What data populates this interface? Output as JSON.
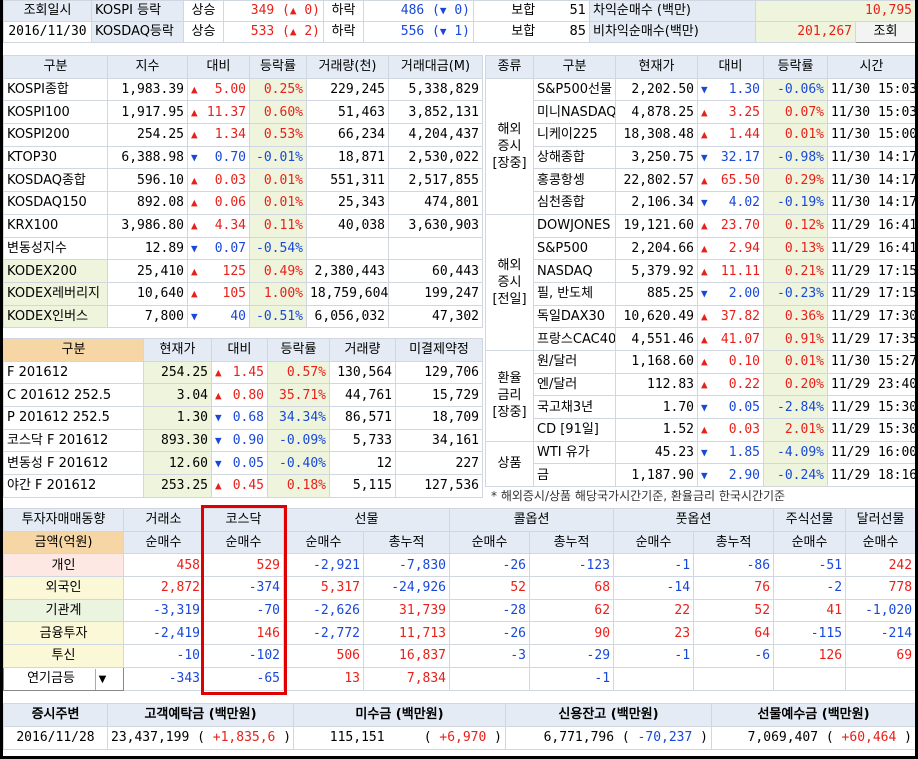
{
  "top": {
    "r1": {
      "c1": "조회일시",
      "c2": "KOSPI 등락",
      "c3": "상승",
      "c4": "349",
      "c5": "0",
      "c6": "하락",
      "c7": "486",
      "c8": "0",
      "c9": "보합",
      "c10": "51",
      "c11": "차익순매수 (백만)",
      "c12": "10,795"
    },
    "r2": {
      "c1": "2016/11/30",
      "c2": "KOSDAQ등락",
      "c3": "상승",
      "c4": "533",
      "c5": "2",
      "c6": "하락",
      "c7": "556",
      "c8": "1",
      "c9": "보합",
      "c10": "85",
      "c11": "비차익순매수(백만)",
      "c12": "201,267"
    },
    "btn": "조회"
  },
  "idx": {
    "headers": [
      "구분",
      "지수",
      "대비",
      "등락률",
      "거래량(천)",
      "거래대금(M)"
    ],
    "rows": [
      [
        "KOSPI종합",
        "1,983.39",
        "up",
        "5.00",
        "0.25%",
        "229,245",
        "5,338,829"
      ],
      [
        "KOSPI100",
        "1,917.95",
        "up",
        "11.37",
        "0.60%",
        "51,463",
        "3,852,131"
      ],
      [
        "KOSPI200",
        "254.25",
        "up",
        "1.34",
        "0.53%",
        "66,234",
        "4,204,437"
      ],
      [
        "KTOP30",
        "6,388.98",
        "dn",
        "0.70",
        "-0.01%",
        "18,871",
        "2,530,022"
      ],
      [
        "KOSDAQ종합",
        "596.10",
        "up",
        "0.03",
        "0.01%",
        "551,311",
        "2,517,855"
      ],
      [
        "KOSDAQ150",
        "892.08",
        "up",
        "0.06",
        "0.01%",
        "25,343",
        "474,801"
      ],
      [
        "KRX100",
        "3,986.80",
        "up",
        "4.34",
        "0.11%",
        "40,038",
        "3,630,903"
      ],
      [
        "변동성지수",
        "12.89",
        "dn",
        "0.07",
        "-0.54%",
        "",
        ""
      ],
      [
        "KODEX200",
        "25,410",
        "up",
        "125",
        "0.49%",
        "2,380,443",
        "60,443"
      ],
      [
        "KODEX레버리지",
        "10,640",
        "up",
        "105",
        "1.00%",
        "18,759,604",
        "199,247"
      ],
      [
        "KODEX인버스",
        "7,800",
        "dn",
        "40",
        "-0.51%",
        "6,056,032",
        "47,302"
      ]
    ]
  },
  "fut": {
    "headers": [
      "구분",
      "현재가",
      "대비",
      "등락률",
      "거래량",
      "미결제약정"
    ],
    "rows": [
      [
        "F 201612",
        "254.25",
        "up",
        "1.45",
        "0.57%",
        "130,564",
        "129,706"
      ],
      [
        "C 201612 252.5",
        "3.04",
        "up",
        "0.80",
        "35.71%",
        "44,761",
        "15,729"
      ],
      [
        "P 201612 252.5",
        "1.30",
        "dn",
        "0.68",
        "34.34%",
        "86,571",
        "18,709"
      ],
      [
        "코스닥 F 201612",
        "893.30",
        "dn",
        "0.90",
        "-0.09%",
        "5,733",
        "34,161"
      ],
      [
        "변동성 F 201612",
        "12.60",
        "dn",
        "0.05",
        "-0.40%",
        "12",
        "227"
      ],
      [
        "야간 F 201612",
        "253.25",
        "up",
        "0.45",
        "0.18%",
        "5,115",
        "127,536"
      ]
    ]
  },
  "ovs": {
    "headers": [
      "종류",
      "구분",
      "현재가",
      "대비",
      "등락률",
      "시간"
    ],
    "groups": [
      "해외\n증시\n[장중]",
      "해외\n증시\n[전일]",
      "환율\n금리\n[장중]",
      "상품"
    ],
    "rows": [
      [
        "S&P500선물",
        "2,202.50",
        "dn",
        "1.30",
        "-0.06%",
        "11/30 15:03"
      ],
      [
        "미니NASDAQ",
        "4,878.25",
        "up",
        "3.25",
        "0.07%",
        "11/30 15:03"
      ],
      [
        "니케이225",
        "18,308.48",
        "up",
        "1.44",
        "0.01%",
        "11/30 15:00"
      ],
      [
        "상해종합",
        "3,250.75",
        "dn",
        "32.17",
        "-0.98%",
        "11/30 14:17"
      ],
      [
        "홍콩항셍",
        "22,802.57",
        "up",
        "65.50",
        "0.29%",
        "11/30 14:17"
      ],
      [
        "심천종합",
        "2,106.34",
        "dn",
        "4.02",
        "-0.19%",
        "11/30 14:17"
      ],
      [
        "DOWJONES",
        "19,121.60",
        "up",
        "23.70",
        "0.12%",
        "11/29 16:41"
      ],
      [
        "S&P500",
        "2,204.66",
        "up",
        "2.94",
        "0.13%",
        "11/29 16:41"
      ],
      [
        "NASDAQ",
        "5,379.92",
        "up",
        "11.11",
        "0.21%",
        "11/29 17:15"
      ],
      [
        "필, 반도체",
        "885.25",
        "dn",
        "2.00",
        "-0.23%",
        "11/29 17:15"
      ],
      [
        "독일DAX30",
        "10,620.49",
        "up",
        "37.82",
        "0.36%",
        "11/29 17:30"
      ],
      [
        "프랑스CAC40",
        "4,551.46",
        "up",
        "41.07",
        "0.91%",
        "11/29 17:35"
      ],
      [
        "원/달러",
        "1,168.60",
        "up",
        "0.10",
        "0.01%",
        "11/30 15:27"
      ],
      [
        "엔/달러",
        "112.83",
        "up",
        "0.22",
        "0.20%",
        "11/29 23:40"
      ],
      [
        "국고채3년",
        "1.70",
        "dn",
        "0.05",
        "-2.84%",
        "11/29 15:30"
      ],
      [
        "CD [91일]",
        "1.52",
        "up",
        "0.03",
        "2.01%",
        "11/29 15:30"
      ],
      [
        "WTI 유가",
        "45.23",
        "dn",
        "1.85",
        "-4.09%",
        "11/29 16:00"
      ],
      [
        "금",
        "1,187.90",
        "dn",
        "2.90",
        "-0.24%",
        "11/29 18:16"
      ]
    ],
    "note": "* 해외증시/상품 해당국가시간기준, 환율금리 한국시간기준"
  },
  "inv": {
    "h1": [
      "투자자매매동향",
      "거래소",
      "코스닥",
      "선물",
      "콜옵션",
      "풋옵션",
      "주식선물",
      "달러선물"
    ],
    "h2": [
      "금액(억원)",
      "순매수",
      "순매수",
      "순매수",
      "총누적",
      "순매수",
      "총누적",
      "순매수",
      "총누적",
      "순매수",
      "순매수"
    ],
    "rows": [
      [
        "개인",
        "458",
        "529",
        "-2,921",
        "-7,830",
        "-26",
        "-123",
        "-1",
        "-86",
        "-51",
        "242"
      ],
      [
        "외국인",
        "2,872",
        "-374",
        "5,317",
        "-24,926",
        "52",
        "68",
        "-14",
        "76",
        "-2",
        "778"
      ],
      [
        "기관계",
        "-3,319",
        "-70",
        "-2,626",
        "31,739",
        "-28",
        "62",
        "22",
        "52",
        "41",
        "-1,020"
      ],
      [
        "금융투자",
        "-2,419",
        "146",
        "-2,772",
        "11,713",
        "-26",
        "90",
        "23",
        "64",
        "-115",
        "-214"
      ],
      [
        "투신",
        "-10",
        "-102",
        "506",
        "16,837",
        "-3",
        "-29",
        "-1",
        "-6",
        "126",
        "69"
      ],
      [
        "연기금등",
        "-343",
        "-65",
        "13",
        "7,834",
        "",
        "-1",
        "",
        "",
        "",
        ""
      ]
    ]
  },
  "bot": {
    "headers": [
      "증시주변",
      "고객예탁금 (백만원)",
      "미수금 (백만원)",
      "신용잔고 (백만원)",
      "선물예수금 (백만원)"
    ],
    "vals": {
      "date": "2016/11/28",
      "dep": "23,437,199",
      "dep_chg": "+1,835,6",
      "mis": "115,151",
      "mis_chg": "+6,970",
      "cre": "6,771,796",
      "cre_chg": "-70,237",
      "fut": "7,069,407",
      "fut_chg": "+60,464"
    }
  }
}
